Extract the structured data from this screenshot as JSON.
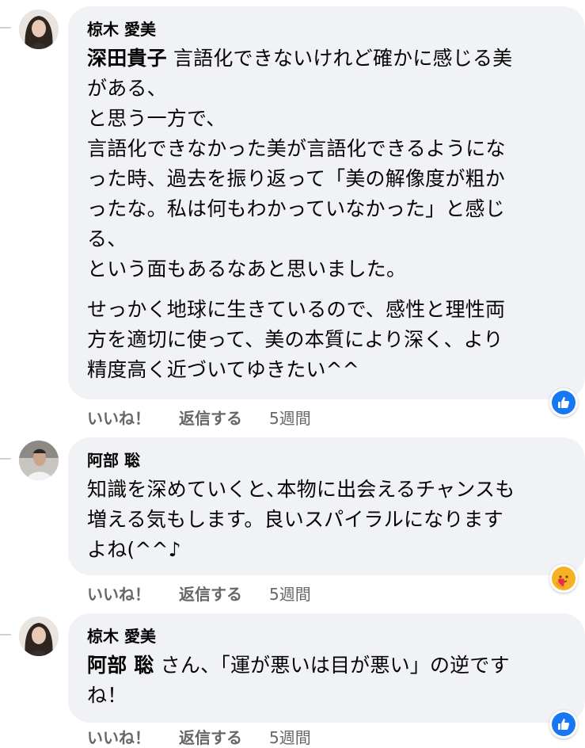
{
  "comments": [
    {
      "author": "椋木 愛美",
      "mention": "深田貴子",
      "paragraphs": [
        " 言語化できないけれど確かに感じる美\nがある、\nと思う一方で、\n言語化できなかった美が言語化できるようにな\nった時、過去を振り返って「美の解像度が粗か\nったな。私は何もわかっていなかった」と感じ\nる、\nという面もあるなあと思いました。",
        "せっかく地球に生きているので、感性と理性両\n方を適切に使って、美の本質により深く、より\n精度高く近づいてゆきたい^^"
      ],
      "actions": {
        "like": "いいね！",
        "reply": "返信する",
        "time": "5週間"
      },
      "reaction": "like-icon"
    },
    {
      "author": "阿部 聡",
      "mention": "",
      "paragraphs": [
        "知識を深めていくと､本物に出会えるチャンスも\n増える気もします。良いスパイラルになります\nよね(^^♪"
      ],
      "actions": {
        "like": "いいね！",
        "reply": "返信する",
        "time": "5週間"
      },
      "reaction": "care-icon"
    },
    {
      "author": "椋木 愛美",
      "mention": "阿部 聡",
      "paragraphs": [
        " さん、「運が悪いは目が悪い」の逆です\nね！"
      ],
      "actions": {
        "like": "いいね！",
        "reply": "返信する",
        "time": "5週間"
      },
      "reaction": "like-icon"
    }
  ],
  "colors": {
    "bubble": "#f0f2f5",
    "text": "#050505",
    "secondary": "#65676b",
    "like_blue": "#1877f2",
    "care_yellow": "#f7b125"
  }
}
